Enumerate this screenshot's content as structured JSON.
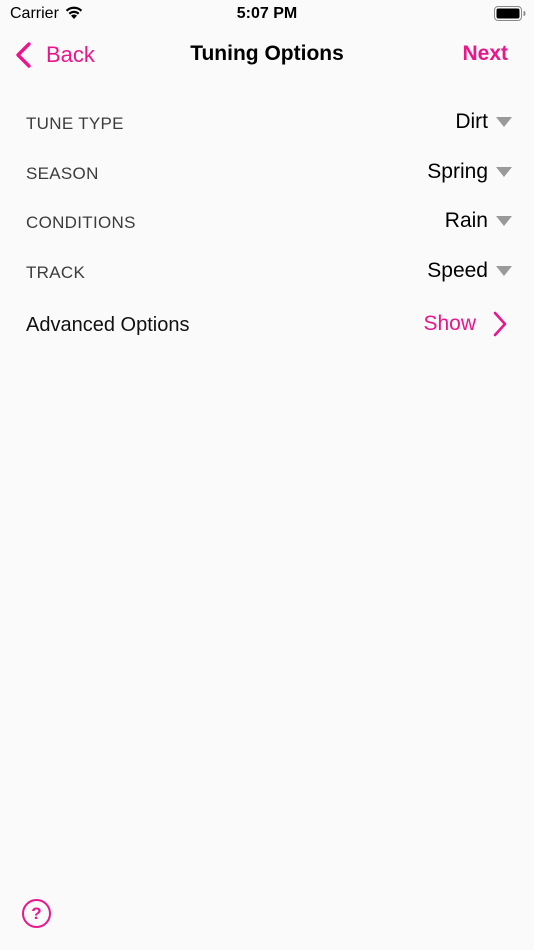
{
  "status_bar": {
    "carrier": "Carrier",
    "time": "5:07 PM"
  },
  "nav": {
    "back_label": "Back",
    "title": "Tuning Options",
    "next_label": "Next"
  },
  "options": [
    {
      "label": "TUNE TYPE",
      "value": "Dirt"
    },
    {
      "label": "SEASON",
      "value": "Spring"
    },
    {
      "label": "CONDITIONS",
      "value": "Rain"
    },
    {
      "label": "TRACK",
      "value": "Speed"
    }
  ],
  "advanced": {
    "label": "Advanced Options",
    "action_label": "Show"
  },
  "help": {
    "glyph": "?"
  },
  "colors": {
    "accent": "#e9168c",
    "background": "#fafafa",
    "caret": "#9a9a9a"
  }
}
